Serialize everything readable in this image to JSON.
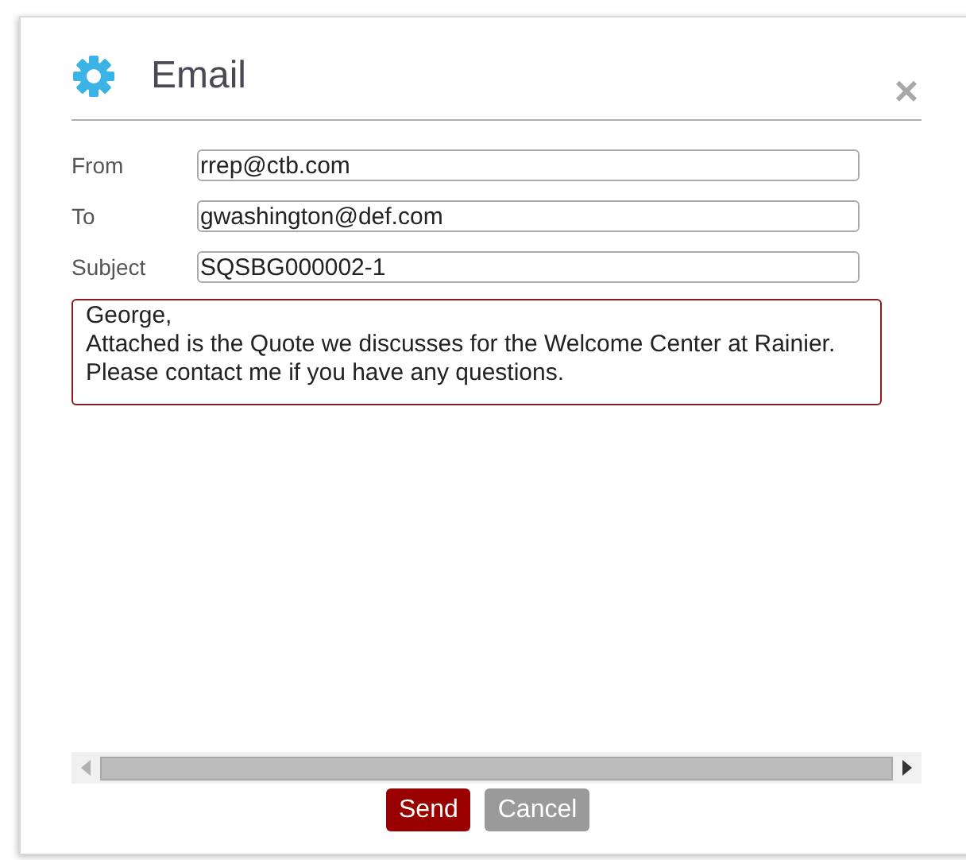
{
  "dialog": {
    "title": "Email",
    "close": "×"
  },
  "fields": [
    {
      "label": "From",
      "value": "rrep@ctb.com"
    },
    {
      "label": "To",
      "value": "gwashington@def.com"
    },
    {
      "label": "Subject",
      "value": "SQSBG000002-1"
    }
  ],
  "message": {
    "value": "George,\nAttached is the Quote we discusses for the Welcome Center at Rainier.\nPlease contact me if you have any questions."
  },
  "buttons": [
    {
      "label": "Send",
      "kind": "primary"
    },
    {
      "label": "Cancel",
      "kind": "secondary"
    }
  ]
}
